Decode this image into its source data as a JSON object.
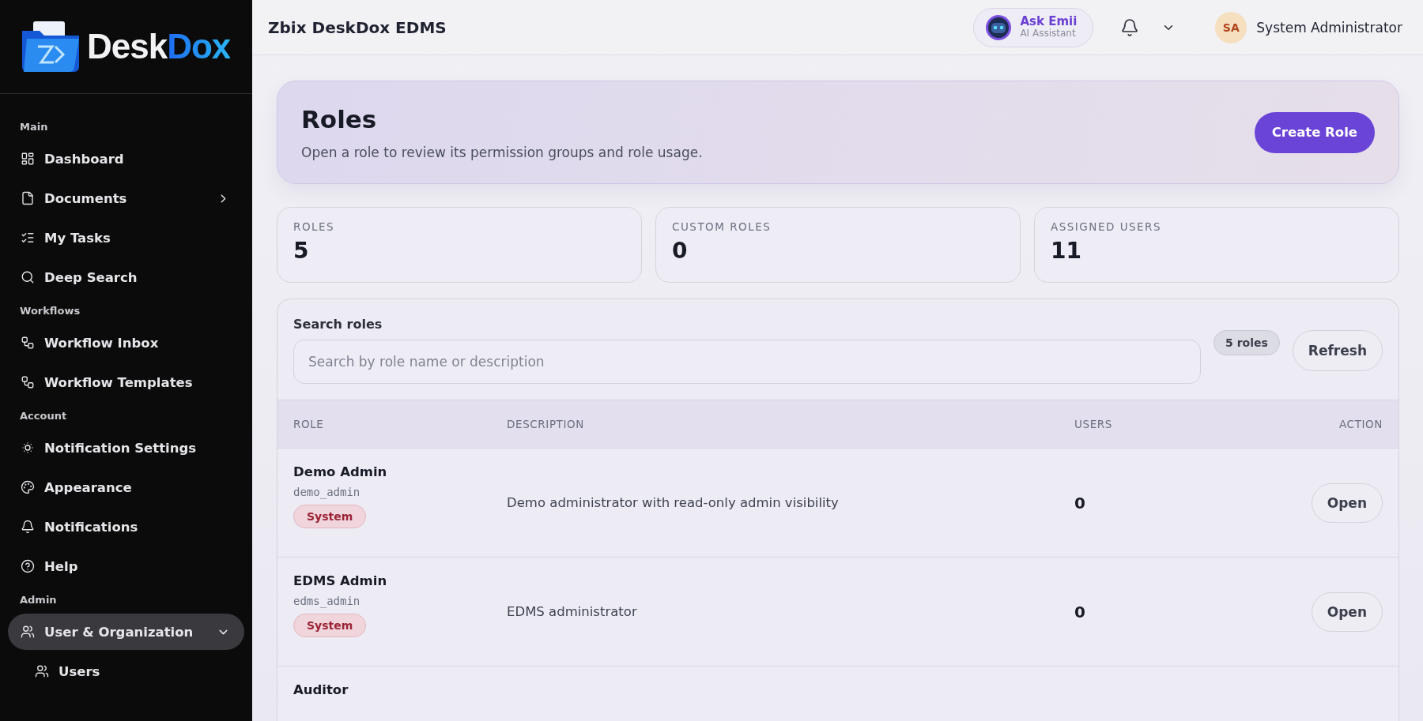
{
  "logo": {
    "first": "Desk",
    "second": "Dox"
  },
  "sidebar": {
    "sections": [
      {
        "label": "Main",
        "items": [
          {
            "label": "Dashboard",
            "selected": false
          },
          {
            "label": "Documents",
            "selected": false,
            "expanded": false
          },
          {
            "label": "My Tasks",
            "selected": false
          },
          {
            "label": "Deep Search",
            "selected": false
          }
        ]
      },
      {
        "label": "Workflows",
        "items": [
          {
            "label": "Workflow Inbox",
            "selected": false
          },
          {
            "label": "Workflow Templates",
            "selected": false
          }
        ]
      },
      {
        "label": "Account",
        "items": [
          {
            "label": "Notification Settings",
            "selected": false
          },
          {
            "label": "Appearance",
            "selected": false
          },
          {
            "label": "Notifications",
            "selected": false
          },
          {
            "label": "Help",
            "selected": false
          }
        ]
      },
      {
        "label": "Admin",
        "items": [
          {
            "label": "User & Organization",
            "selected": true,
            "expanded": true,
            "children": [
              {
                "label": "Users",
                "selected": false
              }
            ]
          }
        ]
      }
    ]
  },
  "header": {
    "title": "Zbix DeskDox EDMS",
    "assistant": {
      "name": "Ask Emii",
      "subtitle": "AI Assistant"
    },
    "user": {
      "initials": "SA",
      "name": "System Administrator"
    }
  },
  "hero": {
    "title": "Roles",
    "subtitle": "Open a role to review its permission groups and role usage.",
    "button": "Create Role"
  },
  "stats": [
    {
      "label": "ROLES",
      "value": "5"
    },
    {
      "label": "CUSTOM ROLES",
      "value": "0"
    },
    {
      "label": "ASSIGNED USERS",
      "value": "11"
    }
  ],
  "search": {
    "label": "Search roles",
    "placeholder": "Search by role name or description",
    "count": "5 roles",
    "button": "Refresh"
  },
  "table": {
    "columns": [
      "ROLE",
      "DESCRIPTION",
      "USERS",
      "ACTION"
    ],
    "rows": [
      {
        "name": "Demo Admin",
        "code": "demo_admin",
        "badge": "System",
        "description": "Demo administrator with read-only admin visibility",
        "users": "0",
        "action": "Open"
      },
      {
        "name": "EDMS Admin",
        "code": "edms_admin",
        "badge": "System",
        "description": "EDMS administrator",
        "users": "0",
        "action": "Open"
      },
      {
        "name": "Auditor"
      }
    ]
  }
}
